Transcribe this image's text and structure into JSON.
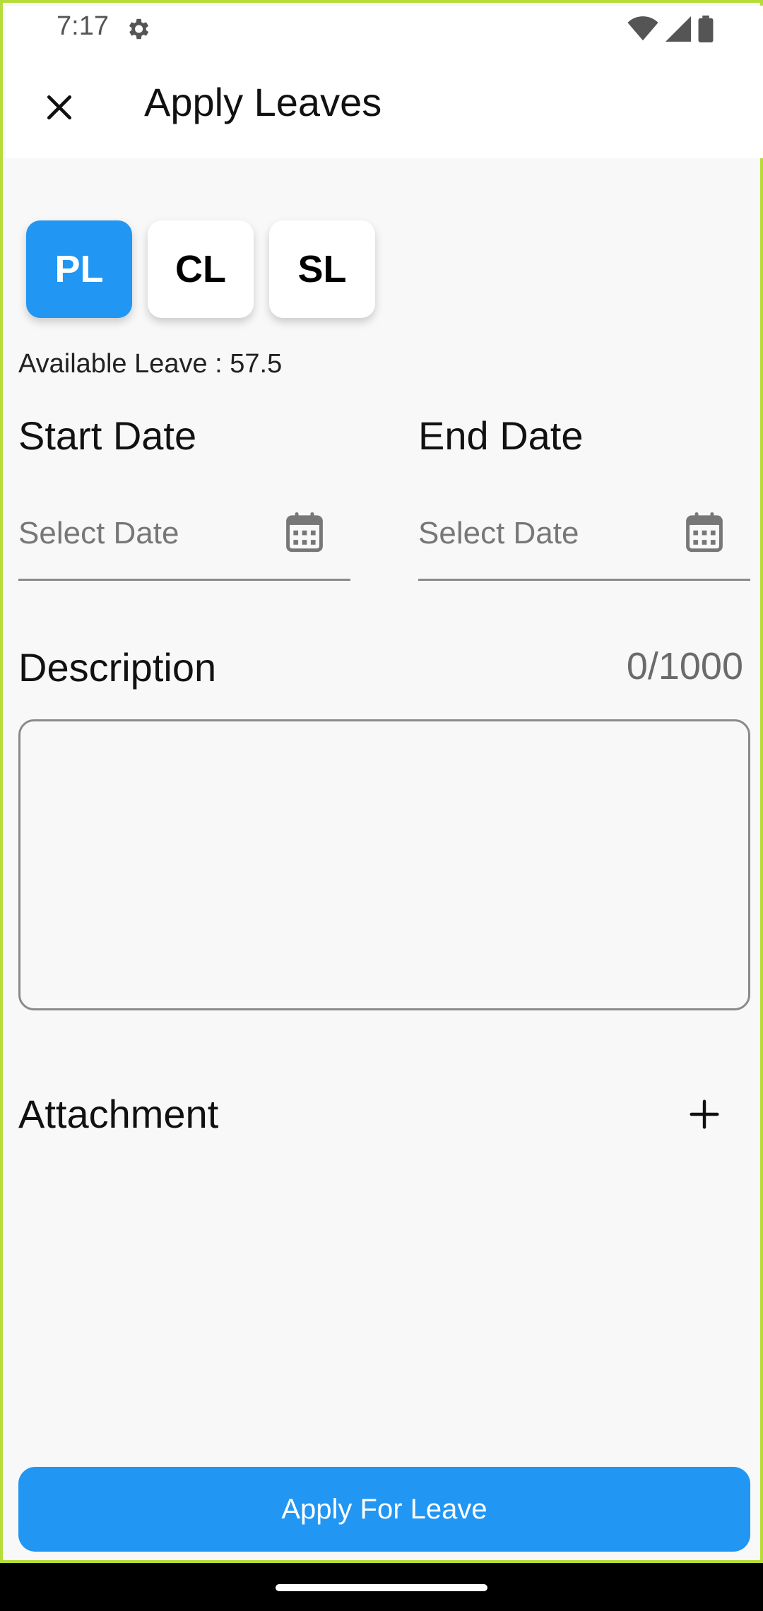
{
  "status_bar": {
    "time": "7:17",
    "icons": [
      "settings-gear-icon",
      "wifi-icon",
      "signal-icon",
      "battery-icon"
    ]
  },
  "app_bar": {
    "title": "Apply Leaves",
    "close_icon": "close-icon"
  },
  "leave_types": {
    "items": [
      {
        "label": "PL",
        "selected": true
      },
      {
        "label": "CL",
        "selected": false
      },
      {
        "label": "SL",
        "selected": false
      }
    ],
    "active_color": "#2196f3"
  },
  "available_leave": "Available Leave : 57.5",
  "start_date": {
    "label": "Start Date",
    "placeholder": "Select Date",
    "icon": "calendar-icon"
  },
  "end_date": {
    "label": "End Date",
    "placeholder": "Select Date",
    "icon": "calendar-icon"
  },
  "description": {
    "label": "Description",
    "counter": "0/1000",
    "value": ""
  },
  "attachment": {
    "label": "Attachment",
    "add_icon": "plus-icon"
  },
  "apply_button": {
    "label": "Apply For Leave",
    "color": "#2196f3"
  }
}
